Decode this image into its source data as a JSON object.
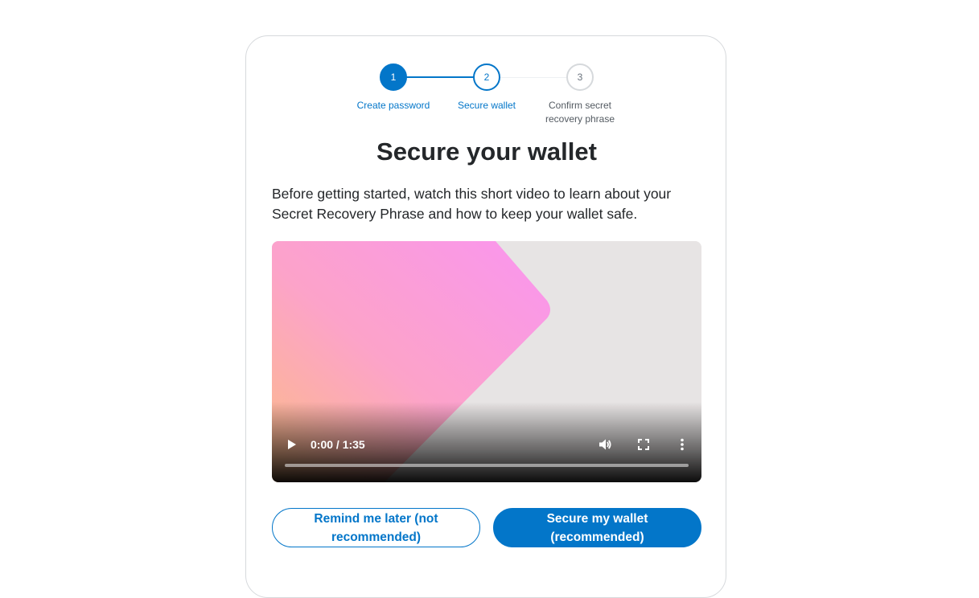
{
  "stepper": {
    "steps": [
      {
        "number": "1",
        "label": "Create password",
        "state": "complete"
      },
      {
        "number": "2",
        "label": "Secure wallet",
        "state": "active"
      },
      {
        "number": "3",
        "label": "Confirm secret recovery phrase",
        "state": "incomplete"
      }
    ]
  },
  "page": {
    "title": "Secure your wallet",
    "description": "Before getting started, watch this short video to learn about your Secret Recovery Phrase and how to keep your wallet safe."
  },
  "video": {
    "time_display": "0:00 / 1:35",
    "progress": 0,
    "icons": {
      "play": "play-icon",
      "volume": "volume-icon",
      "fullscreen": "fullscreen-icon",
      "more": "more-options-icon"
    }
  },
  "actions": {
    "remind_later_label": "Remind me later (not recommended)",
    "secure_wallet_label": "Secure my wallet (recommended)"
  },
  "colors": {
    "accent": "#0376c9",
    "text": "#24272a",
    "muted": "#535a61",
    "border": "#d6d9dc"
  }
}
